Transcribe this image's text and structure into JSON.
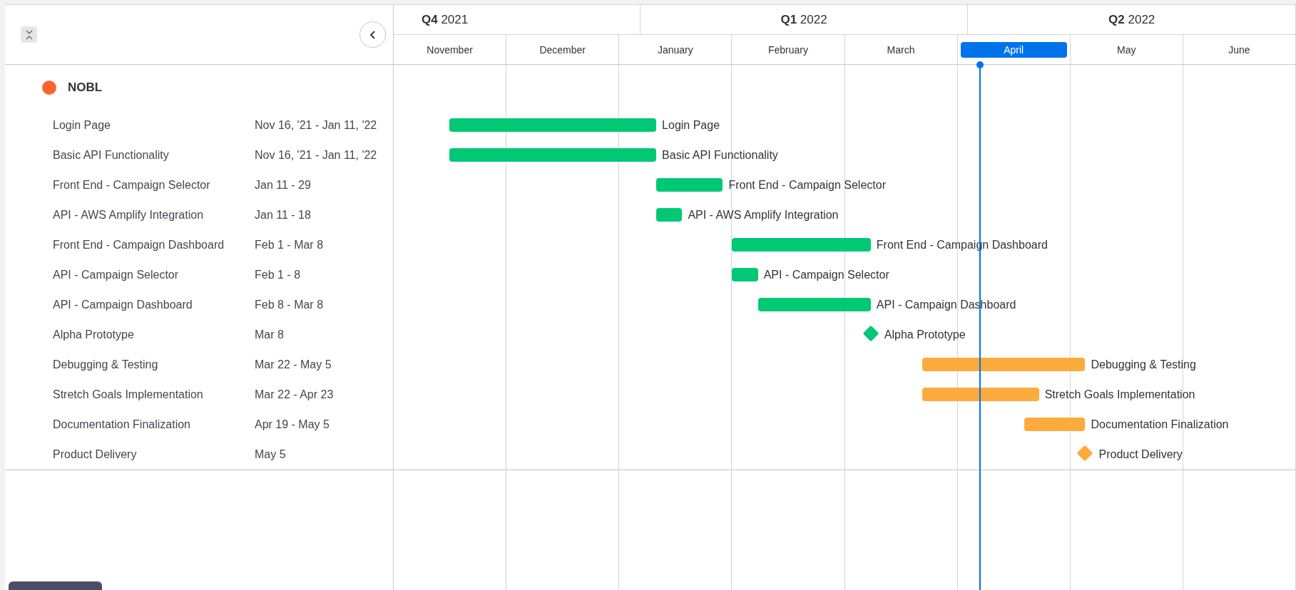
{
  "timeline": {
    "quarters": [
      {
        "label": "**Q4** 2021",
        "clipped": true
      },
      {
        "label": "**Q1** 2022",
        "clipped": false
      },
      {
        "label": "**Q2** 2022",
        "clipped": false
      }
    ],
    "months": [
      {
        "label": "November",
        "selected": false
      },
      {
        "label": "December",
        "selected": false
      },
      {
        "label": "January",
        "selected": false
      },
      {
        "label": "February",
        "selected": false
      },
      {
        "label": "March",
        "selected": false
      },
      {
        "label": "April",
        "selected": true
      },
      {
        "label": "May",
        "selected": false
      },
      {
        "label": "June",
        "selected": false
      }
    ]
  },
  "group": {
    "name": "NOBL",
    "color": "#ff642e"
  },
  "tasks": [
    {
      "name": "Login Page",
      "dates": "Nov 16, '21 - Jan 11, '22",
      "kind": "bar",
      "bar_label": "Login Page",
      "color": "#00c875"
    },
    {
      "name": "Basic API Functionality",
      "dates": "Nov 16, '21 - Jan 11, '22",
      "kind": "bar",
      "bar_label": "Basic API Functionality",
      "color": "#00c875"
    },
    {
      "name": "Front End - Campaign Selector",
      "dates": "Jan 11 - 29",
      "kind": "bar",
      "bar_label": "Front End - Campaign Selector",
      "color": "#00c875"
    },
    {
      "name": "API - AWS Amplify Integration",
      "dates": "Jan 11 - 18",
      "kind": "bar",
      "bar_label": "API - AWS Amplify Integration",
      "color": "#00c875"
    },
    {
      "name": "Front End - Campaign Dashboard",
      "dates": "Feb 1 - Mar 8",
      "kind": "bar",
      "bar_label": "Front End - Campaign Dashboard",
      "color": "#00c875"
    },
    {
      "name": "API - Campaign Selector",
      "dates": "Feb 1 - 8",
      "kind": "bar",
      "bar_label": "API - Campaign Selector",
      "color": "#00c875"
    },
    {
      "name": "API - Campaign Dashboard",
      "dates": "Feb 8 - Mar 8",
      "kind": "bar",
      "bar_label": "API - Campaign Dashboard",
      "color": "#00c875"
    },
    {
      "name": "Alpha Prototype",
      "dates": "Mar 8",
      "kind": "milestone",
      "bar_label": "Alpha Prototype",
      "color": "#00c875"
    },
    {
      "name": "Debugging & Testing",
      "dates": "Mar 22 - May 5",
      "kind": "bar",
      "bar_label": "Debugging & Testing",
      "color": "#fdab3d"
    },
    {
      "name": "Stretch Goals Implementation",
      "dates": "Mar 22 - Apr 23",
      "kind": "bar",
      "bar_label": "Stretch Goals Implementation",
      "color": "#fdab3d"
    },
    {
      "name": "Documentation Finalization",
      "dates": "Apr 19 - May 5",
      "kind": "bar",
      "bar_label": "Documentation Finalization",
      "color": "#fdab3d"
    },
    {
      "name": "Product Delivery",
      "dates": "May 5",
      "kind": "milestone",
      "bar_label": "Product Delivery",
      "color": "#fdab3d"
    }
  ]
}
